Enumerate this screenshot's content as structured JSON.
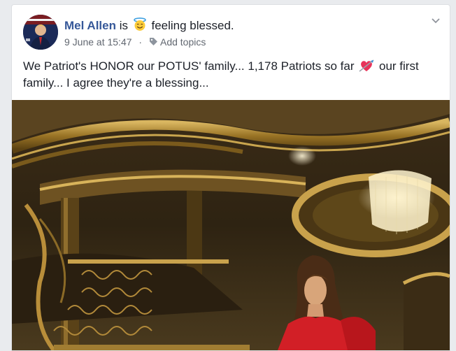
{
  "post": {
    "author": "Mel Allen",
    "is_text": "is",
    "feeling_text": "feeling blessed.",
    "feeling_icon": "smiling-face-with-halo",
    "timestamp": "9 June at 15:47",
    "separator": "·",
    "add_topics": "Add topics",
    "message_part1": "We Patriot's HONOR our POTUS' family... 1,178 Patriots so far",
    "message_part2": "our first family... I agree they're a blessing...",
    "inline_emoji": "heart-with-arrow",
    "photo_description_icon": "photo",
    "colors": {
      "author_link": "#365899",
      "meta_text": "#616770",
      "body_text": "#1d2129"
    }
  }
}
